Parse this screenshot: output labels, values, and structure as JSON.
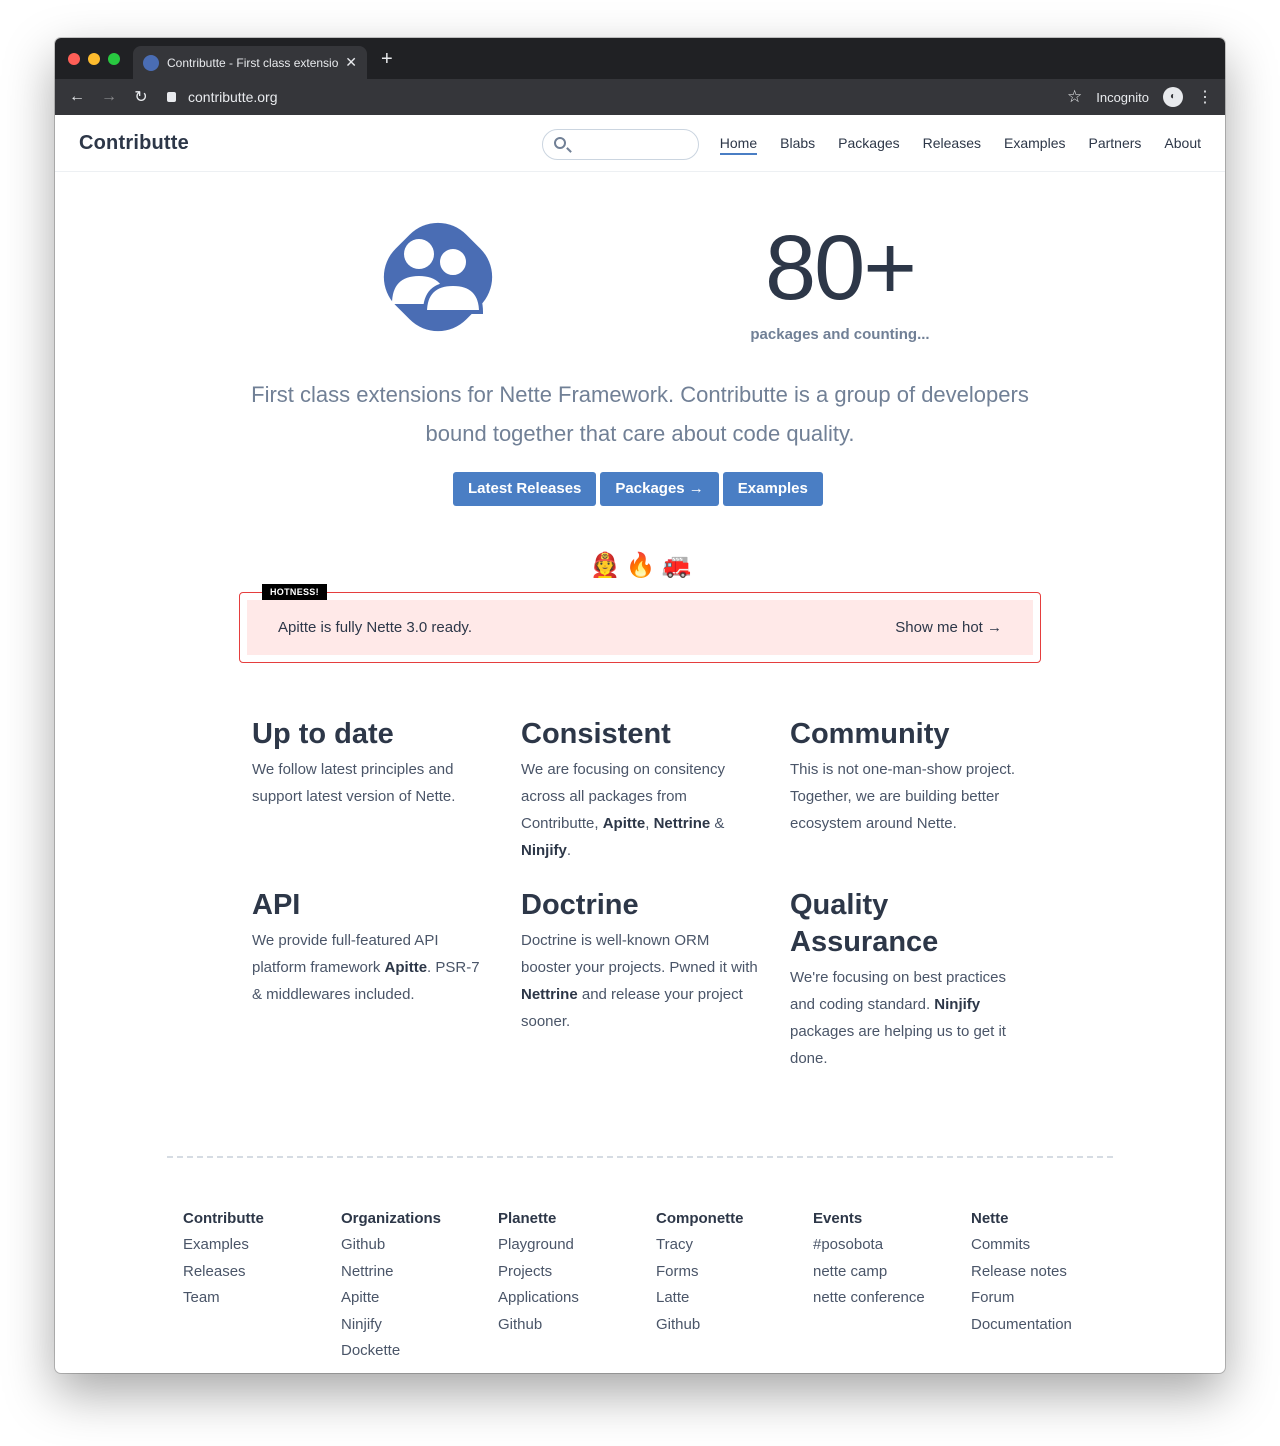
{
  "browser": {
    "tab_title": "Contributte - First class extensio",
    "new_tab": "+",
    "url": "contributte.org",
    "profile_label": "Incognito",
    "traffic_colors": [
      "#ff5f57",
      "#febc2e",
      "#28c840"
    ]
  },
  "header": {
    "logo": "Contributte",
    "search_placeholder": "",
    "nav": [
      "Home",
      "Blabs",
      "Packages",
      "Releases",
      "Examples",
      "Partners",
      "About"
    ],
    "active_nav": "Home"
  },
  "hero": {
    "counter": "80+",
    "counter_sub": "packages and counting...",
    "lead": "First class extensions for Nette Framework. Contributte is a group of developers bound together that care about code quality.",
    "buttons": [
      "Latest Releases",
      "Packages →",
      "Examples"
    ],
    "accent": "#4a7ec4"
  },
  "hot": {
    "emojis": [
      "🧑‍🚒",
      "🔥",
      "🚒"
    ],
    "badge": "HOTNESS!",
    "message": "Apitte is fully Nette 3.0 ready.",
    "link": "Show me hot →"
  },
  "features": [
    {
      "title": "Up to date",
      "parts": [
        {
          "t": "We follow latest principles and support latest version of Nette."
        }
      ]
    },
    {
      "title": "Consistent",
      "parts": [
        {
          "t": "We are focusing on consitency across all packages from Contributte, "
        },
        {
          "t": "Apitte",
          "b": true
        },
        {
          "t": ", "
        },
        {
          "t": "Nettrine",
          "b": true
        },
        {
          "t": " & "
        },
        {
          "t": "Ninjify",
          "b": true
        },
        {
          "t": "."
        }
      ]
    },
    {
      "title": "Community",
      "parts": [
        {
          "t": "This is not one-man-show project. Together, we are building better ecosystem around Nette."
        }
      ]
    },
    {
      "title": "API",
      "parts": [
        {
          "t": "We provide full-featured API platform framework "
        },
        {
          "t": "Apitte",
          "b": true
        },
        {
          "t": ". PSR-7 & middlewares included."
        }
      ]
    },
    {
      "title": "Doctrine",
      "parts": [
        {
          "t": "Doctrine is well-known ORM booster your projects. Pwned it with "
        },
        {
          "t": "Nettrine",
          "b": true
        },
        {
          "t": " and release your project sooner."
        }
      ]
    },
    {
      "title": "Quality Assurance",
      "parts": [
        {
          "t": "We're focusing on best practices and coding standard. "
        },
        {
          "t": "Ninjify",
          "b": true
        },
        {
          "t": " packages are helping us to get it done."
        }
      ]
    }
  ],
  "footer": [
    {
      "title": "Contributte",
      "links": [
        "Examples",
        "Releases",
        "Team"
      ]
    },
    {
      "title": "Organizations",
      "links": [
        "Github",
        "Nettrine",
        "Apitte",
        "Ninjify",
        "Dockette"
      ]
    },
    {
      "title": "Planette",
      "links": [
        "Playground",
        "Projects",
        "Applications",
        "Github"
      ]
    },
    {
      "title": "Componette",
      "links": [
        "Tracy",
        "Forms",
        "Latte",
        "Github"
      ]
    },
    {
      "title": "Events",
      "links": [
        "#posobota",
        "nette camp",
        "nette conference"
      ]
    },
    {
      "title": "Nette",
      "links": [
        "Commits",
        "Release notes",
        "Forum",
        "Documentation"
      ]
    }
  ]
}
